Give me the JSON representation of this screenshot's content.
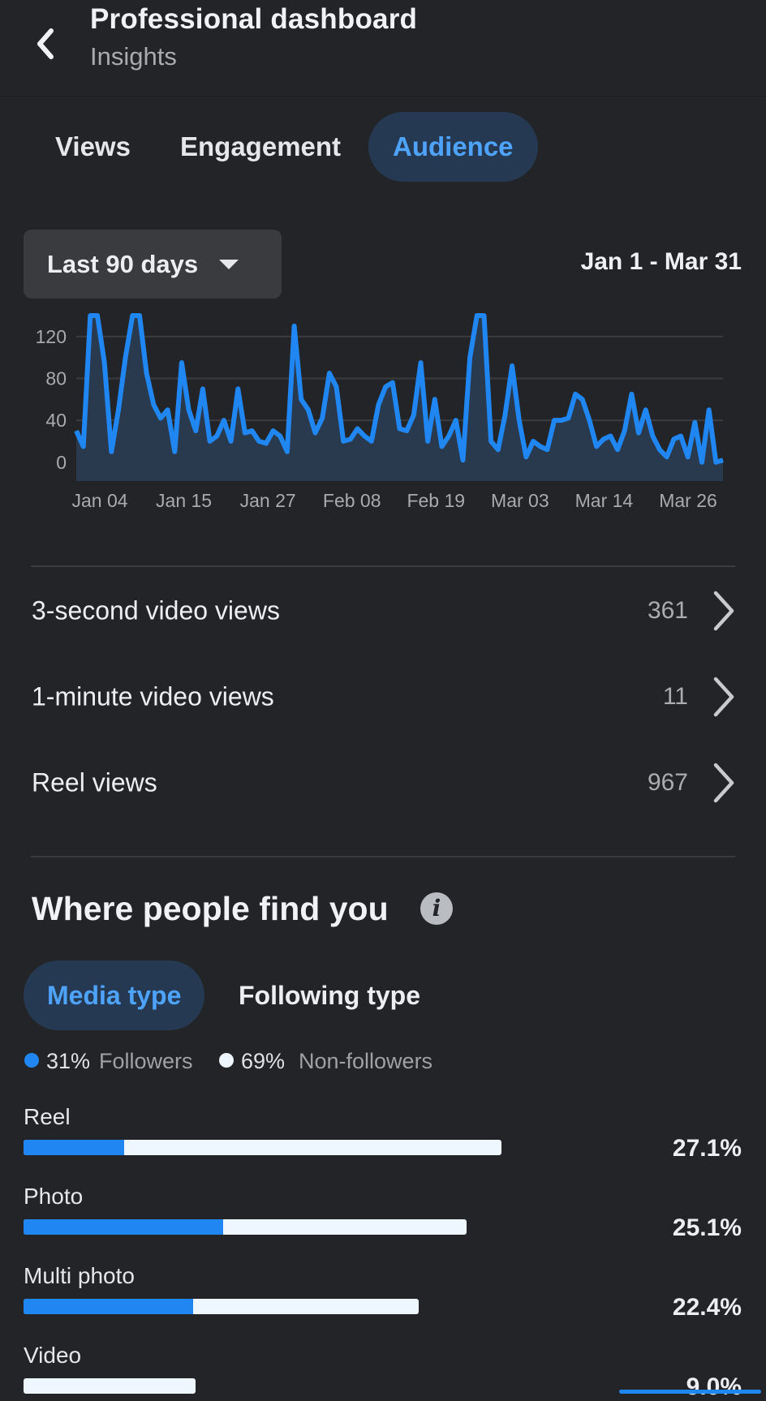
{
  "header": {
    "back_icon": "chevron-left-icon",
    "title": "Professional dashboard",
    "subtitle": "Insights"
  },
  "tabs": [
    {
      "label": "Views",
      "active": false
    },
    {
      "label": "Engagement",
      "active": false
    },
    {
      "label": "Audience",
      "active": true
    }
  ],
  "range_select": {
    "label": "Last 90 days",
    "icon": "caret-down-icon"
  },
  "date_range": "Jan 1 - Mar 31",
  "chart_data": {
    "type": "area",
    "x_tick_labels": [
      "Jan 04",
      "Jan 15",
      "Jan 27",
      "Feb 08",
      "Feb 19",
      "Mar 03",
      "Mar 14",
      "Mar 26"
    ],
    "y_tick_labels": [
      "120",
      "80",
      "40",
      "0"
    ],
    "ylim": [
      -18,
      140
    ],
    "grid": true,
    "line_color": "#1f86f2",
    "fill_color": "#2a3a4e",
    "x_start": "Jan 01",
    "x_end": "Mar 31",
    "values": [
      30,
      15,
      140,
      140,
      95,
      10,
      50,
      100,
      140,
      140,
      85,
      55,
      42,
      50,
      10,
      95,
      50,
      30,
      70,
      20,
      25,
      40,
      20,
      70,
      28,
      30,
      20,
      18,
      30,
      25,
      10,
      130,
      60,
      50,
      28,
      42,
      85,
      72,
      20,
      22,
      32,
      25,
      20,
      55,
      72,
      76,
      32,
      30,
      45,
      95,
      20,
      60,
      15,
      25,
      40,
      2,
      100,
      140,
      140,
      20,
      12,
      45,
      92,
      40,
      5,
      20,
      15,
      12,
      40,
      40,
      42,
      65,
      60,
      40,
      15,
      22,
      25,
      12,
      30,
      65,
      28,
      50,
      25,
      12,
      5,
      22,
      25,
      5,
      38,
      0,
      50,
      0,
      2
    ]
  },
  "metrics": [
    {
      "label": "3-second video views",
      "value": "361"
    },
    {
      "label": "1-minute video views",
      "value": "11"
    },
    {
      "label": "Reel views",
      "value": "967"
    }
  ],
  "where": {
    "title": "Where people find you",
    "info_icon": "info-icon",
    "segments": [
      {
        "label": "Media type",
        "active": true
      },
      {
        "label": "Following type",
        "active": false
      }
    ],
    "legend": [
      {
        "pct": "31%",
        "name": "Followers",
        "color": "#1f86f2"
      },
      {
        "pct": "69%",
        "name": "Non-followers",
        "color": "#eef6ff"
      }
    ],
    "bars": [
      {
        "label": "Reel",
        "pct": "27.1%",
        "share": 27.1,
        "followers_fraction": 0.21
      },
      {
        "label": "Photo",
        "pct": "25.1%",
        "share": 25.1,
        "followers_fraction": 0.45
      },
      {
        "label": "Multi photo",
        "pct": "22.4%",
        "share": 22.4,
        "followers_fraction": 0.43
      },
      {
        "label": "Video",
        "pct": "9.0%",
        "share": 9.0,
        "followers_fraction": 0.0
      }
    ]
  }
}
